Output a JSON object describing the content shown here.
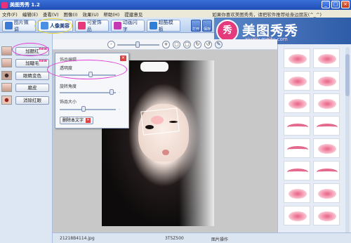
{
  "window": {
    "title": "美图秀秀 1.2",
    "min": "_",
    "max": "□",
    "close": "×"
  },
  "menu": {
    "items": [
      "文件(F)",
      "编辑(E)",
      "查看(V)",
      "图像(I)",
      "效果(U)",
      "帮助(H)",
      "提建意见"
    ],
    "promo": "如果你喜欢美图秀秀，请把软件推荐给身边朋友(^_^)"
  },
  "tabs": [
    {
      "label": "图片微调",
      "color": "#3a7bd5"
    },
    {
      "label": "人像美容",
      "color": "#4a90e2"
    },
    {
      "label": "可爱饰品",
      "color": "#e6387a"
    },
    {
      "label": "动画闪字",
      "color": "#c43ab2"
    },
    {
      "label": "超酷模板",
      "color": "#2f7fd8"
    }
  ],
  "logo": {
    "badge": "秀",
    "text": "美图秀秀",
    "url": "xiuxiu.meitu.com"
  },
  "side_buttons": [
    "打开",
    "保存"
  ],
  "toolbar": {
    "zoom_out": "-",
    "zoom_in": "+"
  },
  "features": [
    {
      "label": "加腮红",
      "new": "new"
    },
    {
      "label": "加睫毛",
      "new": "new"
    },
    {
      "label": "眼睛变色",
      "new": ""
    },
    {
      "label": "磨皮",
      "new": ""
    },
    {
      "label": "消除红眼",
      "new": ""
    }
  ],
  "popup": {
    "title": "饰品编辑",
    "opacity_label": "透明度",
    "rotation_label": "旋转角度",
    "size_label": "饰品大小",
    "rotation_value": "-",
    "size_value": "-",
    "delete_label": "删除本文字",
    "opacity": 0.55,
    "rotation": 0.92,
    "size": 0.42
  },
  "status": {
    "filename": "21218B4114.jpg",
    "dimensions": "3T5Z500",
    "mode": "图片操作"
  },
  "colors": {
    "accent": "#e43ad6",
    "brand": "#e33b7c"
  }
}
